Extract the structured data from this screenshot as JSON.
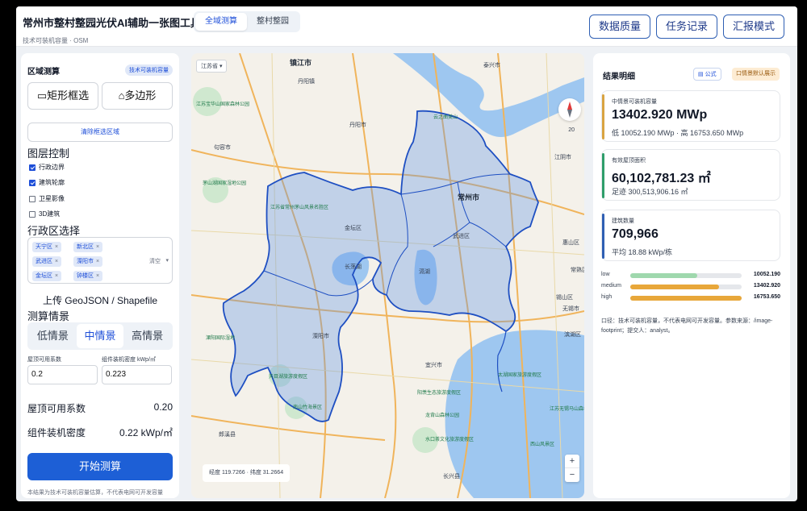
{
  "header": {
    "title": "常州市整村整园光伏AI辅助一张图工具",
    "subtitle": "技术可装机容量 · OSM",
    "tabs": [
      "全域测算",
      "整村整园"
    ],
    "buttons": [
      "数据质量",
      "任务记录",
      "汇报模式"
    ]
  },
  "left": {
    "region_title": "区域测算",
    "badge": "技术可装机容量",
    "rect_btn": "▭矩形框选",
    "poly_btn": "⌂多边形",
    "clear_btn": "清除框选区域",
    "layer_title": "图层控制",
    "layers": [
      {
        "label": "行政边界",
        "checked": true
      },
      {
        "label": "建筑轮廓",
        "checked": true
      },
      {
        "label": "卫星影像",
        "checked": false
      },
      {
        "label": "3D建筑",
        "checked": false
      }
    ],
    "district_title": "行政区选择",
    "districts": [
      "天宁区",
      "新北区",
      "武进区",
      "溧阳市",
      "金坛区",
      "钟楼区"
    ],
    "district_clear": "清空",
    "upload": "上传 GeoJSON / Shapefile",
    "scenario_title": "测算情景",
    "scenarios": [
      "低情景",
      "中情景",
      "高情景"
    ],
    "roof_label": "屋顶可用系数",
    "density_label": "组件装机密度 kWp/㎡",
    "roof_value": "0.2",
    "density_value": "0.223",
    "roof_row_label": "屋顶可用系数",
    "roof_row_value": "0.20",
    "density_row_label": "组件装机密度",
    "density_row_value": "0.22 kWp/㎡",
    "start_btn": "开始测算",
    "note": "本结果为技术可装机容量估算，不代表电网可开发容量"
  },
  "map": {
    "province_select": "江苏省",
    "scale": "20",
    "coords": "经度 119.7266 · 纬度 31.2664",
    "zoom_in": "+",
    "zoom_out": "−",
    "places": {
      "zhenjiang": "镇江市",
      "taixing": "泰兴市",
      "danyang_l": "丹阳镇",
      "danyang": "丹阳市",
      "jurong": "句容市",
      "changzhou": "常州市",
      "jiangyin": "江阴市",
      "jintan": "金坛区",
      "wujin": "武进区",
      "huishan": "惠山区",
      "liyang": "溧阳市",
      "yixing": "宜兴市",
      "wuxi": "无锡市",
      "xishan": "锡山区",
      "langxi": "郎溪县",
      "changxing": "长兴县",
      "changshu": "常熟区",
      "gehu": "滆湖",
      "changdang": "长荡湖",
      "binhu": "滨湖区"
    },
    "pois": {
      "p1": "江苏宝华山国家森林公园",
      "p2": "茅山湖国家湿地公园",
      "p3": "江苏省常州茅山风景名胜区",
      "p4": "天目湖旅游度假区",
      "p5": "南山竹海景区",
      "p6": "阳羡生态旅游度假区",
      "p7": "太湖国家旅游度假区",
      "p8": "江苏无锡马山森林公园",
      "p9": "溧阳国际湿地",
      "p10": "龙背山森林公园",
      "p11": "云之曲美山",
      "p12": "水口茶文化旅游度假区",
      "p13": "西山风景区"
    }
  },
  "right": {
    "title": "结果明细",
    "formula_btn": "公式",
    "default_btn": "口情景默认展示",
    "cards": [
      {
        "label": "中情景可装机容量",
        "value": "13402.920 MWp",
        "sub": "低 10052.190 MWp · 高 16753.650 MWp",
        "color": "#d9a441"
      },
      {
        "label": "有效屋顶面积",
        "value": "60,102,781.23 ㎡",
        "sub": "足迹 300,513,906.16 ㎡",
        "color": "#2f9e6a"
      },
      {
        "label": "建筑数量",
        "value": "709,966",
        "sub": "平均 18.88 kWp/栋",
        "color": "#2f5fb3"
      }
    ],
    "levels": [
      {
        "name": "low",
        "value": "10052.190",
        "ratio": 0.6,
        "color": "#9fd8ad"
      },
      {
        "name": "medium",
        "value": "13402.920",
        "ratio": 0.8,
        "color": "#e8a73a"
      },
      {
        "name": "high",
        "value": "16753.650",
        "ratio": 1.0,
        "color": "#e8a73a"
      }
    ],
    "caliber": "口径：技术可装机容量，不代表电网可开发容量。参数来源：/image-footprint；提交人：analyst。"
  }
}
